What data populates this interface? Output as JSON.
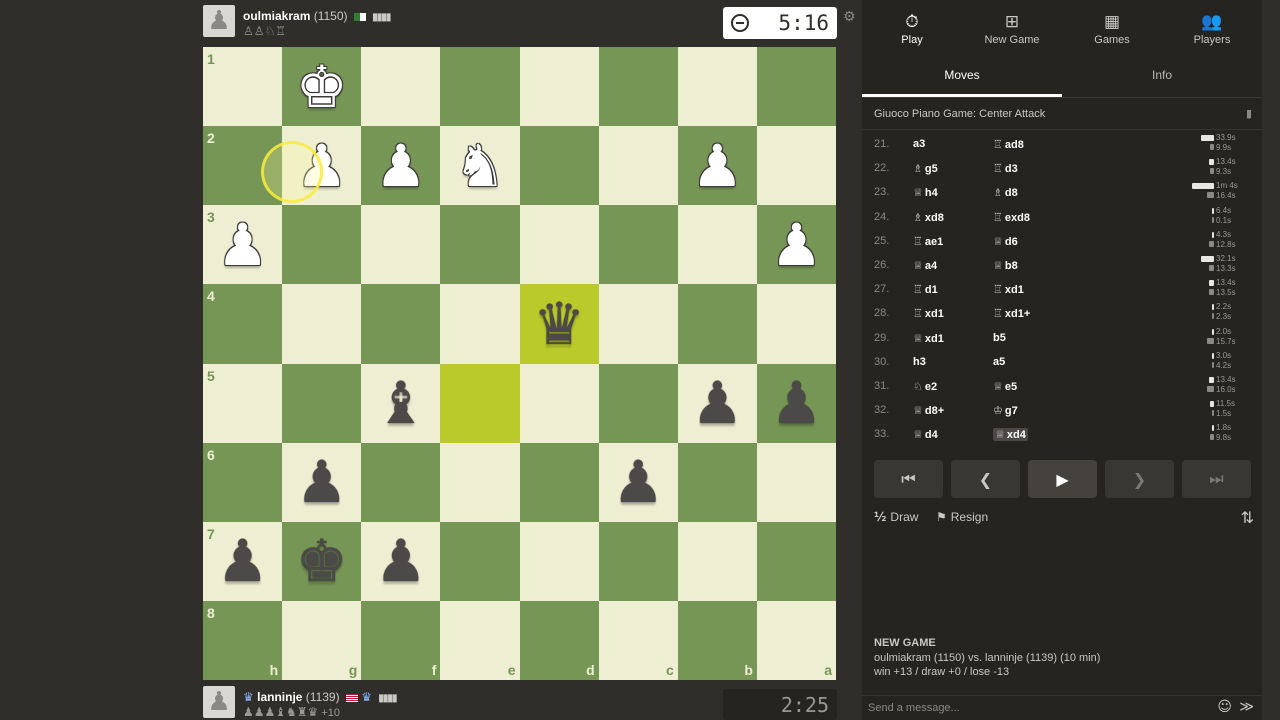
{
  "top_player": {
    "name": "oulmiakram",
    "rating": "(1150)",
    "captured": "♙♙♘♖",
    "clock": "5:16",
    "avatar_icon": "pawn-avatar-icon",
    "flag_icon": "algeria-flag-icon"
  },
  "bottom_player": {
    "name": "lanninje",
    "rating": "(1139)",
    "captured": "♟♟♟♝♞♜♛",
    "advantage": "+10",
    "clock": "2:25",
    "avatar_icon": "pawn-avatar-icon",
    "flag_icon": "usa-flag-icon"
  },
  "board": {
    "ranks": [
      "1",
      "2",
      "3",
      "4",
      "5",
      "6",
      "7",
      "8"
    ],
    "files": [
      "h",
      "g",
      "f",
      "e",
      "d",
      "c",
      "b",
      "a"
    ],
    "light_color": "#eeeed2",
    "dark_color": "#769656",
    "highlight_color": "#baca2b",
    "pieces": [
      {
        "square": "g1",
        "glyph": "♚",
        "color": "w",
        "name": "white-king"
      },
      {
        "square": "g2",
        "glyph": "♟",
        "color": "w",
        "name": "white-pawn"
      },
      {
        "square": "f2",
        "glyph": "♟",
        "color": "w",
        "name": "white-pawn"
      },
      {
        "square": "e2",
        "glyph": "♞",
        "color": "w",
        "name": "white-knight"
      },
      {
        "square": "b2",
        "glyph": "♟",
        "color": "w",
        "name": "white-pawn"
      },
      {
        "square": "h3",
        "glyph": "♟",
        "color": "w",
        "name": "white-pawn"
      },
      {
        "square": "a3",
        "glyph": "♟",
        "color": "w",
        "name": "white-pawn"
      },
      {
        "square": "d4",
        "glyph": "♛",
        "color": "b",
        "name": "black-queen"
      },
      {
        "square": "f5",
        "glyph": "♝",
        "color": "b",
        "name": "black-bishop"
      },
      {
        "square": "b5",
        "glyph": "♟",
        "color": "b",
        "name": "black-pawn"
      },
      {
        "square": "a5",
        "glyph": "♟",
        "color": "b",
        "name": "black-pawn"
      },
      {
        "square": "g6",
        "glyph": "♟",
        "color": "b",
        "name": "black-pawn"
      },
      {
        "square": "c6",
        "glyph": "♟",
        "color": "b",
        "name": "black-pawn"
      },
      {
        "square": "h7",
        "glyph": "♟",
        "color": "b",
        "name": "black-pawn"
      },
      {
        "square": "g7",
        "glyph": "♚",
        "color": "b",
        "name": "black-king"
      },
      {
        "square": "f7",
        "glyph": "♟",
        "color": "b",
        "name": "black-pawn"
      }
    ],
    "highlighted": [
      "d4",
      "e5"
    ]
  },
  "nav": [
    {
      "label": "Play",
      "icon": "stopwatch-icon",
      "glyph": "⏱",
      "active": true
    },
    {
      "label": "New Game",
      "icon": "plus-square-icon",
      "glyph": "⊞",
      "active": false
    },
    {
      "label": "Games",
      "icon": "chessboard-icon",
      "glyph": "▦",
      "active": false
    },
    {
      "label": "Players",
      "icon": "players-icon",
      "glyph": "👥",
      "active": false
    }
  ],
  "tabs": [
    {
      "label": "Moves",
      "active": true
    },
    {
      "label": "Info",
      "active": false
    }
  ],
  "opening": "Giuoco Piano Game: Center Attack",
  "moves": [
    {
      "num": "21.",
      "w": {
        "icon": "",
        "san": "a3"
      },
      "b": {
        "icon": "♖",
        "san": "ad8"
      },
      "tw": "33.9s",
      "tb": "9.9s",
      "bw": 0.6,
      "bb": 0.2
    },
    {
      "num": "22.",
      "w": {
        "icon": "♗",
        "san": "g5"
      },
      "b": {
        "icon": "♖",
        "san": "d3"
      },
      "tw": "13.4s",
      "tb": "9.3s",
      "bw": 0.25,
      "bb": 0.2
    },
    {
      "num": "23.",
      "w": {
        "icon": "♕",
        "san": "h4"
      },
      "b": {
        "icon": "♗",
        "san": "d8"
      },
      "tw": "1m 4s",
      "tb": "16.4s",
      "bw": 1.0,
      "bb": 0.3
    },
    {
      "num": "24.",
      "w": {
        "icon": "♗",
        "san": "xd8"
      },
      "b": {
        "icon": "♖",
        "san": "exd8"
      },
      "tw": "6.4s",
      "tb": "0.1s",
      "bw": 0.1,
      "bb": 0.05
    },
    {
      "num": "25.",
      "w": {
        "icon": "♖",
        "san": "ae1"
      },
      "b": {
        "icon": "♕",
        "san": "d6"
      },
      "tw": "4.3s",
      "tb": "12.8s",
      "bw": 0.08,
      "bb": 0.25
    },
    {
      "num": "26.",
      "w": {
        "icon": "♕",
        "san": "a4"
      },
      "b": {
        "icon": "♕",
        "san": "b8"
      },
      "tw": "32.1s",
      "tb": "13.3s",
      "bw": 0.6,
      "bb": 0.25
    },
    {
      "num": "27.",
      "w": {
        "icon": "♖",
        "san": "d1"
      },
      "b": {
        "icon": "♖",
        "san": "xd1"
      },
      "tw": "13.4s",
      "tb": "13.5s",
      "bw": 0.25,
      "bb": 0.25
    },
    {
      "num": "28.",
      "w": {
        "icon": "♖",
        "san": "xd1"
      },
      "b": {
        "icon": "♖",
        "san": "xd1+"
      },
      "tw": "2.2s",
      "tb": "2.3s",
      "bw": 0.05,
      "bb": 0.05
    },
    {
      "num": "29.",
      "w": {
        "icon": "♕",
        "san": "xd1"
      },
      "b": {
        "icon": "",
        "san": "b5"
      },
      "tw": "2.0s",
      "tb": "15.7s",
      "bw": 0.05,
      "bb": 0.3
    },
    {
      "num": "30.",
      "w": {
        "icon": "",
        "san": "h3"
      },
      "b": {
        "icon": "",
        "san": "a5"
      },
      "tw": "3.0s",
      "tb": "4.2s",
      "bw": 0.06,
      "bb": 0.08
    },
    {
      "num": "31.",
      "w": {
        "icon": "♘",
        "san": "e2"
      },
      "b": {
        "icon": "♕",
        "san": "e5"
      },
      "tw": "13.4s",
      "tb": "16.0s",
      "bw": 0.25,
      "bb": 0.3
    },
    {
      "num": "32.",
      "w": {
        "icon": "♕",
        "san": "d8+"
      },
      "b": {
        "icon": "♔",
        "san": "g7"
      },
      "tw": "11.5s",
      "tb": "1.5s",
      "bw": 0.2,
      "bb": 0.04
    },
    {
      "num": "33.",
      "w": {
        "icon": "♕",
        "san": "d4"
      },
      "b": {
        "icon": "♕",
        "san": "xd4"
      },
      "tw": "1.8s",
      "tb": "9.8s",
      "bw": 0.04,
      "bb": 0.2,
      "current": "b"
    }
  ],
  "controls": [
    {
      "name": "first-move-button",
      "glyph": "⏮"
    },
    {
      "name": "previous-move-button",
      "glyph": "❮"
    },
    {
      "name": "play-button",
      "glyph": "▶"
    },
    {
      "name": "next-move-button",
      "glyph": "❯"
    },
    {
      "name": "last-move-button",
      "glyph": "⏭"
    }
  ],
  "actions": {
    "draw": "Draw",
    "draw_icon": "½",
    "resign": "Resign",
    "resign_icon": "⚑",
    "flip_icon": "⇅"
  },
  "new_game": {
    "title": "NEW GAME",
    "players_line": "oulmiakram (1150) vs. lanninje (1139) (10 min)",
    "score_line": "win +13 / draw +0 / lose -13"
  },
  "chat": {
    "placeholder": "Send a message...",
    "emoji_icon": "☺",
    "send_icon": "≫"
  }
}
